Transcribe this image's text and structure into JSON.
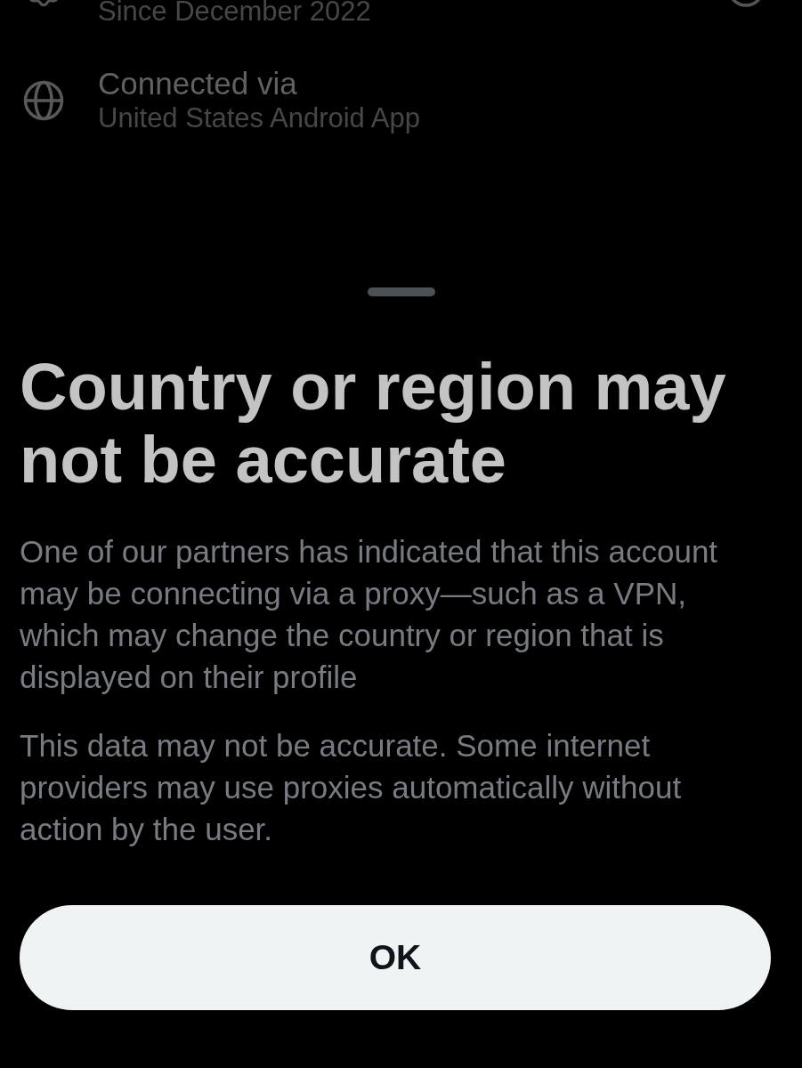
{
  "background_rows": [
    {
      "kind": "badge",
      "detail": "Since December 2022"
    },
    {
      "kind": "globe",
      "label": "Connected via",
      "detail": "United States Android App"
    }
  ],
  "sheet": {
    "title": "Country or region may not be accurate",
    "paragraphs": [
      "One of our partners has indicated that this account may be connecting via a proxy—such as a VPN, which may change the country or region that is displayed on their profile",
      "This data may not be accurate. Some internet providers may use proxies automatically without action by the user."
    ],
    "button": "OK"
  }
}
